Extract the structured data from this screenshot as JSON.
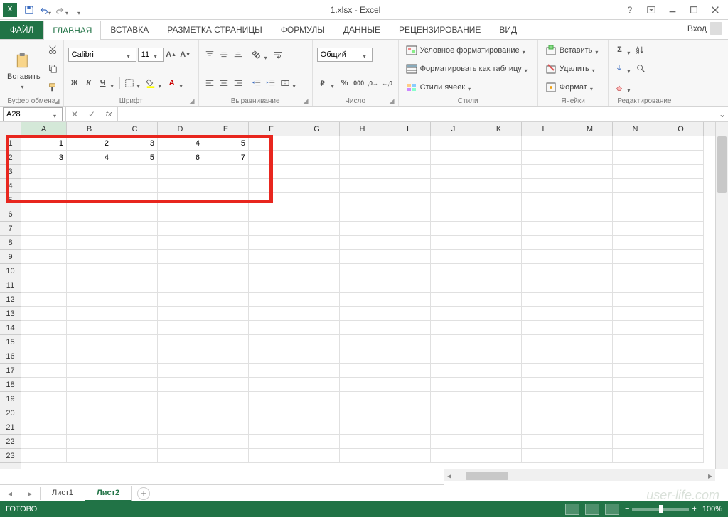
{
  "title": {
    "doc": "1.xlsx",
    "app": "Excel",
    "combined": "1.xlsx - Excel"
  },
  "login": "Вход",
  "file_tab": "ФАЙЛ",
  "ribbon_tabs": [
    "ГЛАВНАЯ",
    "ВСТАВКА",
    "РАЗМЕТКА СТРАНИЦЫ",
    "ФОРМУЛЫ",
    "ДАННЫЕ",
    "РЕЦЕНЗИРОВАНИЕ",
    "ВИД"
  ],
  "active_tab_index": 0,
  "groups": {
    "clipboard": {
      "label": "Буфер обмена",
      "paste": "Вставить"
    },
    "font": {
      "label": "Шрифт",
      "name": "Calibri",
      "size": "11"
    },
    "alignment": {
      "label": "Выравнивание"
    },
    "number": {
      "label": "Число",
      "format": "Общий"
    },
    "styles": {
      "label": "Стили",
      "cond": "Условное форматирование",
      "table": "Форматировать как таблицу",
      "cell": "Стили ячеек"
    },
    "cells": {
      "label": "Ячейки",
      "insert": "Вставить",
      "delete": "Удалить",
      "format": "Формат"
    },
    "editing": {
      "label": "Редактирование"
    }
  },
  "namebox": "A28",
  "columns": [
    "A",
    "B",
    "C",
    "D",
    "E",
    "F",
    "G",
    "H",
    "I",
    "J",
    "K",
    "L",
    "M",
    "N",
    "O"
  ],
  "row_count": 23,
  "data_rows": [
    [
      "1",
      "2",
      "3",
      "4",
      "5"
    ],
    [
      "3",
      "4",
      "5",
      "6",
      "7"
    ]
  ],
  "sheets": [
    "Лист1",
    "Лист2"
  ],
  "active_sheet_index": 1,
  "status": "ГОТОВО",
  "zoom": "100%",
  "watermark": "user-life.com"
}
